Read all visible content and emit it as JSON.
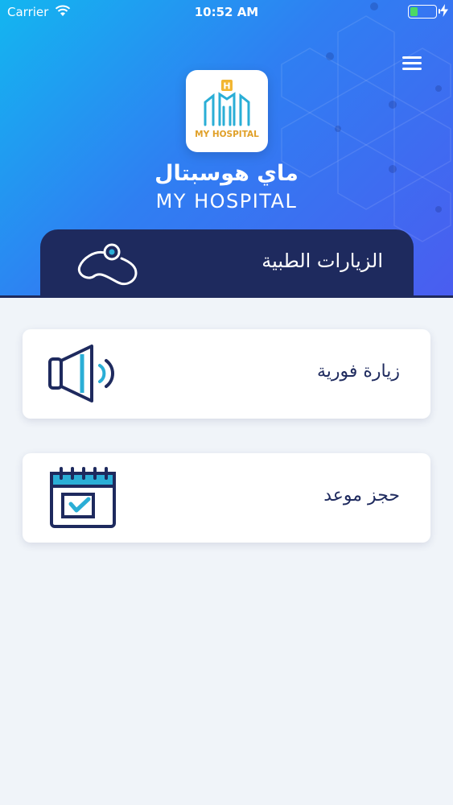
{
  "status_bar": {
    "carrier": "Carrier",
    "time": "10:52 AM"
  },
  "header": {
    "logo_caption": "MY HOSPITAL",
    "brand_arabic": "ماي هوسبتال",
    "brand_english": "MY HOSPITAL"
  },
  "section": {
    "title": "الزيارات الطبية",
    "icon": "stethoscope-icon"
  },
  "cards": [
    {
      "label": "زيارة فورية",
      "icon": "megaphone-icon"
    },
    {
      "label": "حجز موعد",
      "icon": "calendar-check-icon"
    }
  ],
  "colors": {
    "header_gradient_start": "#13b6f0",
    "header_gradient_end": "#4a5df0",
    "navy": "#1e2a5e",
    "accent": "#2f8fe8",
    "background": "#f0f4f9"
  }
}
